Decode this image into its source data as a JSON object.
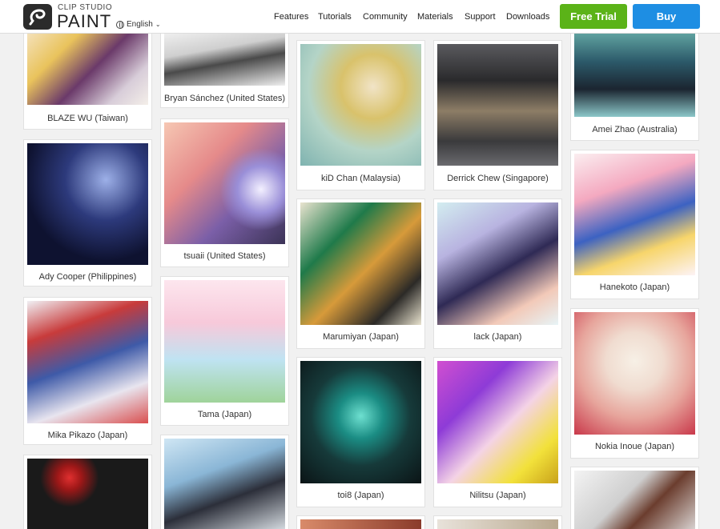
{
  "header": {
    "logo_top": "CLIP STUDIO",
    "logo_main": "PAINT",
    "language": "English",
    "nav": [
      "Features",
      "Tutorials",
      "Community",
      "Materials",
      "Support",
      "Downloads"
    ],
    "free_trial": "Free Trial",
    "buy": "Buy"
  },
  "colors": {
    "free_trial": "#5bb318",
    "buy": "#1e8ee3"
  },
  "gallery": [
    "BLAZE WU (Taiwan)",
    "Ady Cooper (Philippines)",
    "Mika Pikazo (Japan)",
    "Bryan Sánchez (United States)",
    "tsuaii (United States)",
    "Tama (Japan)",
    "kiD Chan (Malaysia)",
    "Marumiyan (Japan)",
    "toi8 (Japan)",
    "Derrick Chew (Singapore)",
    "lack (Japan)",
    "Nilitsu (Japan)",
    "Amei Zhao (Australia)",
    "Hanekoto (Japan)",
    "Nokia Inoue (Japan)"
  ]
}
